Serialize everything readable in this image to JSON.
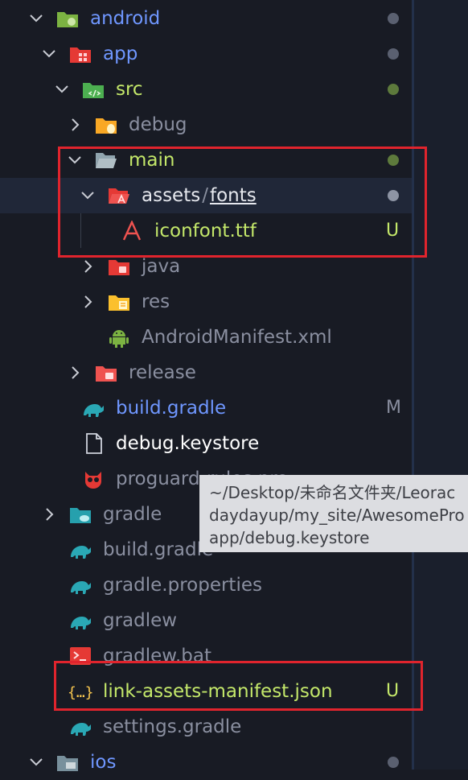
{
  "colors": {
    "folder_label": "#6f97ff",
    "file_label": "#cfd3dc",
    "untracked": "#c4e86a",
    "modified": "#6a8dff",
    "muted": "#8a8fa0",
    "highlight": "#e0242d"
  },
  "tree": {
    "android": {
      "label": "android",
      "icon": "android-folder-icon"
    },
    "app": {
      "label": "app",
      "icon": "app-folder-icon"
    },
    "src": {
      "label": "src",
      "icon": "src-folder-icon"
    },
    "debug": {
      "label": "debug",
      "icon": "debug-folder-icon"
    },
    "main": {
      "label": "main",
      "icon": "folder-open-icon"
    },
    "assets": {
      "label": "assets",
      "separator": "/",
      "sublabel": "fonts",
      "icon": "assets-folder-icon"
    },
    "iconfont": {
      "label": "iconfont.ttf",
      "status": "U",
      "icon": "font-file-icon"
    },
    "java": {
      "label": "java",
      "icon": "java-folder-icon"
    },
    "res": {
      "label": "res",
      "icon": "res-folder-icon"
    },
    "manifest": {
      "label": "AndroidManifest.xml",
      "icon": "android-icon"
    },
    "release": {
      "label": "release",
      "icon": "release-folder-icon"
    },
    "app_build_gradle": {
      "label": "build.gradle",
      "status": "M",
      "icon": "gradle-icon"
    },
    "keystore": {
      "label": "debug.keystore",
      "icon": "file-icon"
    },
    "proguard": {
      "label": "proguard-rules.pro",
      "icon": "proguard-icon"
    },
    "gradle_dir": {
      "label": "gradle",
      "icon": "gradle-folder-icon"
    },
    "build_gradle": {
      "label": "build.gradle",
      "icon": "gradle-icon"
    },
    "gradle_properties": {
      "label": "gradle.properties",
      "icon": "gradle-icon"
    },
    "gradlew": {
      "label": "gradlew",
      "icon": "gradle-icon"
    },
    "gradlew_bat": {
      "label": "gradlew.bat",
      "icon": "terminal-icon"
    },
    "link_manifest": {
      "label": "link-assets-manifest.json",
      "status": "U",
      "icon": "json-braces-icon"
    },
    "settings_gradle": {
      "label": "settings.gradle",
      "icon": "gradle-icon"
    },
    "ios": {
      "label": "ios",
      "icon": "ios-folder-icon"
    }
  },
  "tooltip": {
    "line1": "~/Desktop/未命名文件夹/Leorac",
    "line2": "daydayup/my_site/AwesomePro",
    "line3": "app/debug.keystore"
  }
}
